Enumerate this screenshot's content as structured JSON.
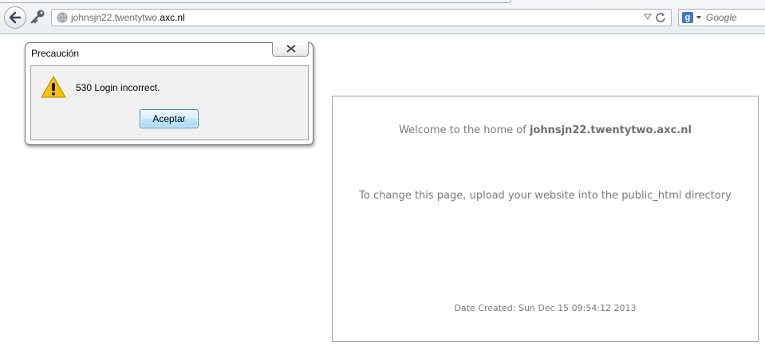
{
  "browser": {
    "url_prefix": "johnsjn22.twentytwo.",
    "url_domain": "axc.nl",
    "search_placeholder": "Google",
    "search_engine_letter": "g"
  },
  "dialog": {
    "title": "Precaución",
    "message": "530 Login incorrect.",
    "accept_label": "Aceptar"
  },
  "page": {
    "welcome_prefix": "Welcome to the home of ",
    "welcome_domain": "johnsjn22.twentytwo.axc.nl",
    "instructions": "To change this page, upload your website into the public_html directory",
    "date_created": "Date Created: Sun Dec 15 09:54:12 2013"
  },
  "colors": {
    "toolbar_bg": "#e9edf2",
    "button_accent": "#3c7fb1",
    "text_gray": "#7a7a7a",
    "warning_yellow": "#f5c400"
  }
}
